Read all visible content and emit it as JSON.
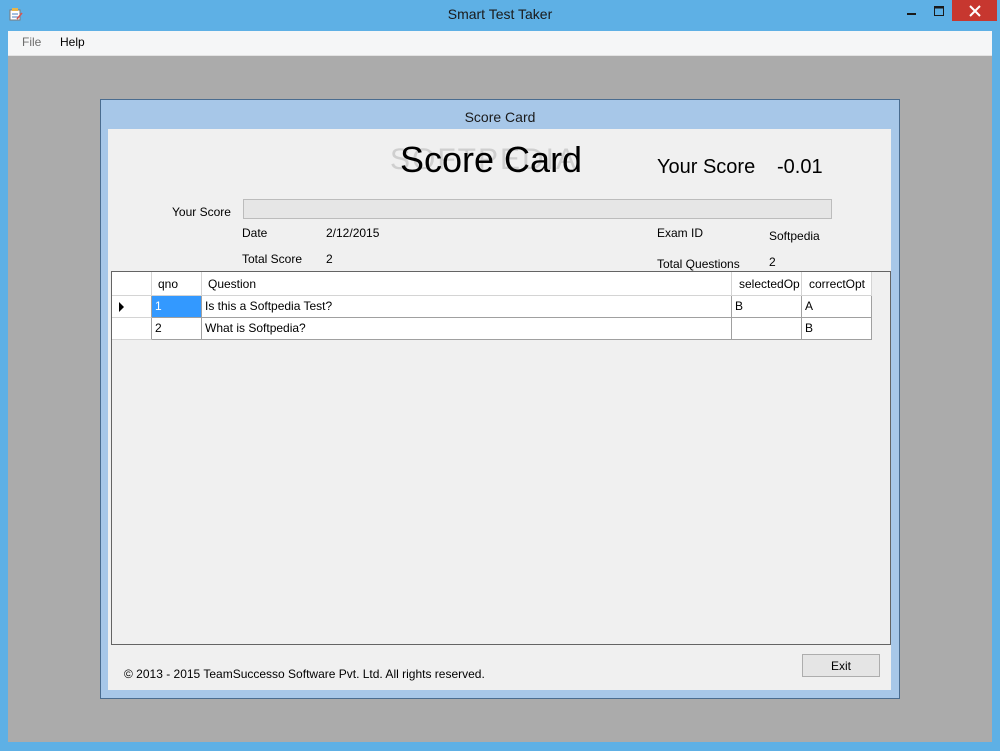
{
  "window": {
    "title": "Smart Test Taker"
  },
  "menu": {
    "file": "File",
    "help": "Help"
  },
  "dialog": {
    "title": "Score Card",
    "heading": "Score Card",
    "watermark": "SOFTPEDIA",
    "your_score_heading": "Your Score",
    "your_score_value": "-0.01",
    "your_score_label": "Your Score",
    "score_progress_fraction": 0,
    "date_label": "Date",
    "date_value": "2/12/2015",
    "exam_id_label": "Exam ID",
    "exam_id_value": "Softpedia",
    "total_score_label": "Total Score",
    "total_score_value": "2",
    "total_questions_label": "Total Questions",
    "total_questions_value": "2",
    "copyright": "© 2013 - 2015 TeamSuccesso Software Pvt. Ltd. All rights reserved.",
    "exit_label": "Exit"
  },
  "grid": {
    "columns": [
      "qno",
      "Question",
      "selectedOp",
      "correctOpt"
    ],
    "rows": [
      {
        "qno": "1",
        "question": "Is this a Softpedia Test?",
        "selected": "B",
        "correct": "A"
      },
      {
        "qno": "2",
        "question": "What is Softpedia?",
        "selected": "",
        "correct": "B"
      }
    ]
  },
  "colors": {
    "frame": "#5eb0e5",
    "close": "#c7372f",
    "selection": "#3399ff",
    "progress_fill": "#06b025"
  }
}
